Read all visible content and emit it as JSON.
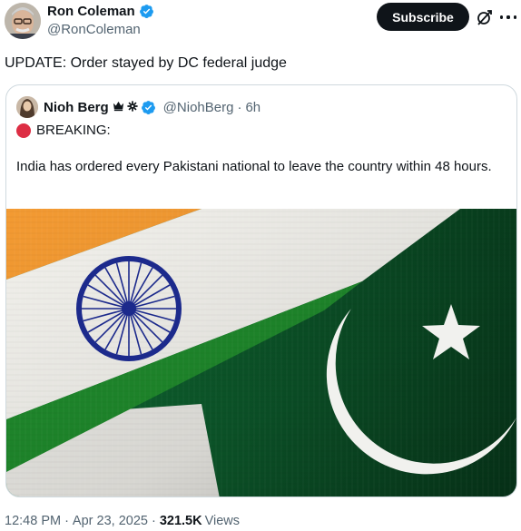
{
  "author": {
    "name": "Ron Coleman",
    "handle": "@RonColeman",
    "verified": true
  },
  "actions": {
    "subscribe_label": "Subscribe",
    "icons": [
      "grok-icon",
      "more-icon"
    ]
  },
  "tweet": {
    "text": "UPDATE: Order stayed by DC federal judge"
  },
  "quote": {
    "name": "Nioh Berg",
    "badges": [
      "crown-icon",
      "gear-icon"
    ],
    "handle": "@NiohBerg",
    "separator": "·",
    "time": "6h",
    "breaking": "BREAKING:",
    "body": "India has ordered every Pakistani national to leave the country within 48 hours.",
    "image_alt": "India and Pakistan flags"
  },
  "meta": {
    "time": "12:48 PM",
    "date": "Apr 23, 2025",
    "separator": "·",
    "views_count": "321.5K",
    "views_label": "Views"
  },
  "colors": {
    "text": "#0f1419",
    "muted": "#536471",
    "verified": "#1d9bf0",
    "button": "#0f1419",
    "saffron": "#f39a32",
    "india_green": "#1f8a2c",
    "pak_green": "#0b5a2a",
    "chakra": "#1c2a8c"
  }
}
